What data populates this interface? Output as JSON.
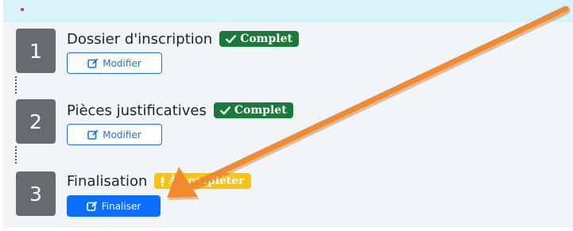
{
  "steps": [
    {
      "number": "1",
      "title": "Dossier d'inscription",
      "badge": {
        "label": "Complet",
        "icon": "check-icon"
      },
      "button": {
        "label": "Modifier",
        "icon": "edit-icon"
      }
    },
    {
      "number": "2",
      "title": "Pièces justificatives",
      "badge": {
        "label": "Complet",
        "icon": "check-icon"
      },
      "button": {
        "label": "Modifier",
        "icon": "edit-icon"
      }
    },
    {
      "number": "3",
      "title": "Finalisation",
      "badge": {
        "label": "À compléter",
        "icon": "exclamation-icon"
      },
      "button": {
        "label": "Finaliser",
        "icon": "edit-icon"
      }
    }
  ],
  "colors": {
    "panel_background": "#f1f5f8",
    "alert_background": "#d9f3fa",
    "step_number_background": "#666b71",
    "badge_complete": "#1a7a3a",
    "badge_warning": "#f7c21e",
    "primary_blue": "#0d6efd",
    "annotation_arrow": "#f28a2e"
  },
  "annotation": {
    "type": "arrow",
    "icon": "arrow-annotation"
  }
}
